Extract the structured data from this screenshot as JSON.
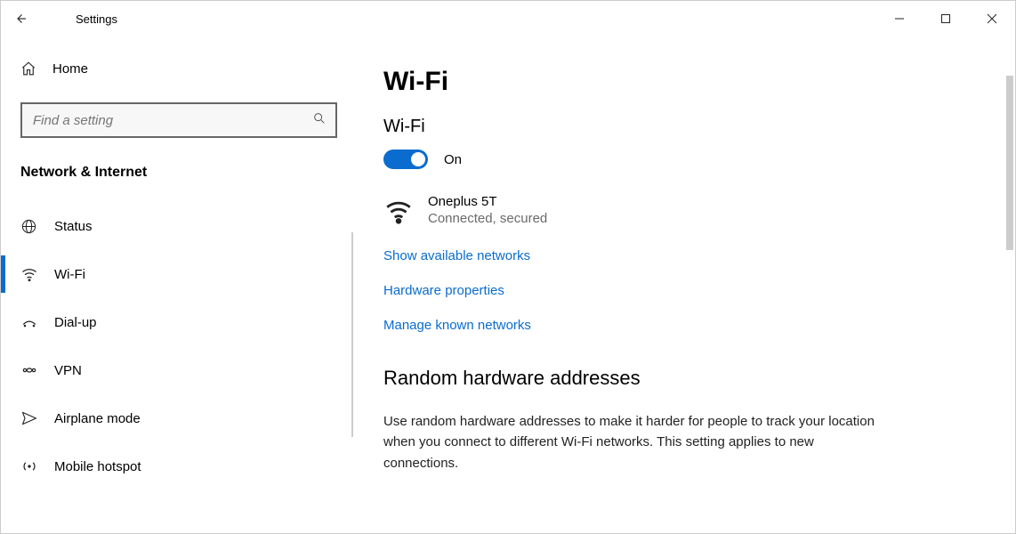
{
  "titlebar": {
    "title": "Settings"
  },
  "sidebar": {
    "home_label": "Home",
    "search_placeholder": "Find a setting",
    "section_heading": "Network & Internet",
    "items": [
      {
        "icon": "globe",
        "label": "Status",
        "selected": false
      },
      {
        "icon": "wifi",
        "label": "Wi-Fi",
        "selected": true
      },
      {
        "icon": "dialup",
        "label": "Dial-up",
        "selected": false
      },
      {
        "icon": "vpn",
        "label": "VPN",
        "selected": false
      },
      {
        "icon": "airplane",
        "label": "Airplane mode",
        "selected": false
      },
      {
        "icon": "hotspot",
        "label": "Mobile hotspot",
        "selected": false
      }
    ]
  },
  "main": {
    "page_title": "Wi-Fi",
    "wifi_section_label": "Wi-Fi",
    "toggle_state_label": "On",
    "toggle_on": true,
    "connection": {
      "name": "Oneplus 5T",
      "status": "Connected, secured"
    },
    "links": {
      "show_networks": "Show available networks",
      "hardware_properties": "Hardware properties",
      "manage_known": "Manage known networks"
    },
    "random_hw": {
      "heading": "Random hardware addresses",
      "body": "Use random hardware addresses to make it harder for people to track your location when you connect to different Wi-Fi networks. This setting applies to new connections."
    }
  }
}
